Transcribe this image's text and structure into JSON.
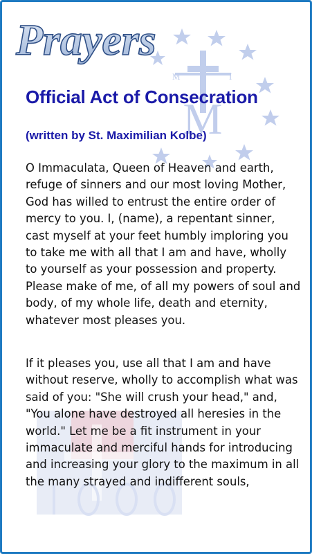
{
  "header": {
    "logo_text": "Prayers"
  },
  "prayer": {
    "title": "Official Act of Consecration",
    "subtitle": "(written by St. Maximilian Kolbe)",
    "paragraphs": [
      "O Immaculata, Queen of Heaven and earth, refuge of sinners and our most loving Mother, God has willed to entrust the entire order of mercy to you. I, (name), a repentant sinner, cast myself at your feet humbly imploring you to take me with all that I am and have, wholly to yourself as your possession and property. Please make of me, of all my powers of soul and body, of my whole life, death and eternity, whatever most pleases you.",
      "If it pleases you, use all that I am and have without reserve, wholly to accomplish what was said of you: \"She will crush your head,\" and, \"You alone have destroyed all heresies in the world.\" Let me be a fit instrument in your immaculate and merciful hands for introducing and increasing your glory to the maximum in all the many strayed and indifferent souls,"
    ]
  },
  "colors": {
    "frame_border": "#1f7bc2",
    "title": "#1a1aa8",
    "body_text": "#111111",
    "emblem": "#8fa6dd",
    "emblem_red": "#d85a6a"
  },
  "icons": {
    "emblem": "miraculous-medal-emblem-icon",
    "watermark": "medal-watermark-icon"
  }
}
